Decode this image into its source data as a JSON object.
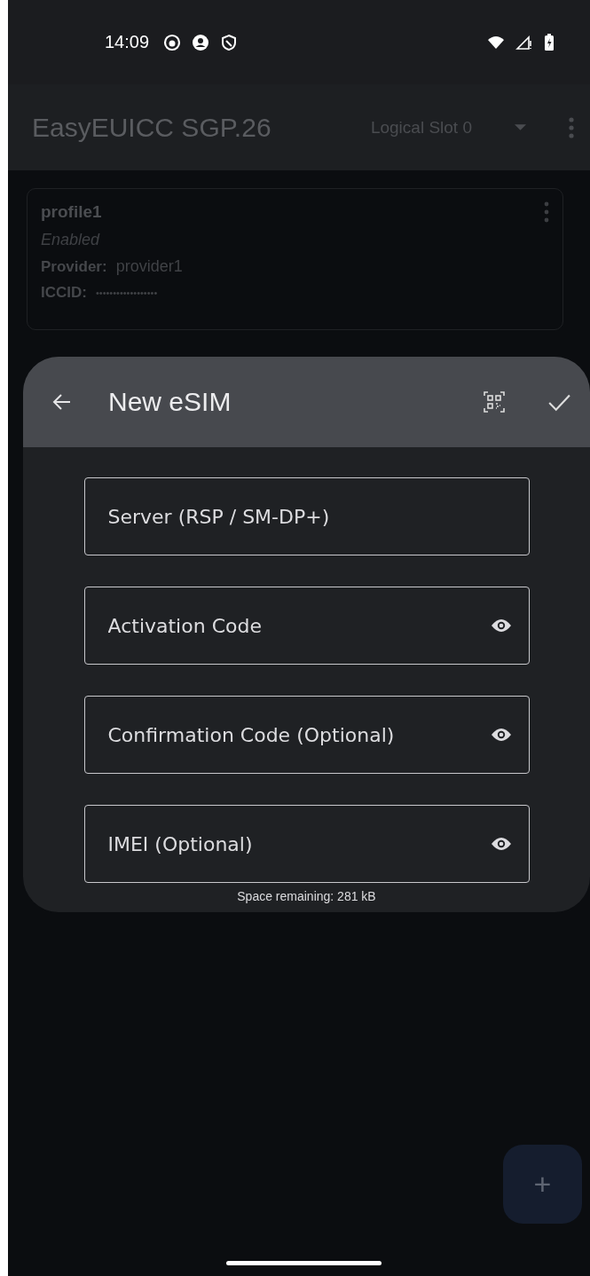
{
  "status_bar": {
    "time": "14:09"
  },
  "app_bar": {
    "title": "EasyEUICC SGP.26",
    "slot_selector": "Logical Slot 0"
  },
  "profile": {
    "name": "profile1",
    "state": "Enabled",
    "provider_label": "Provider:",
    "provider": "provider1",
    "iccid_label": "ICCID:",
    "iccid": "••••••••••••••••••"
  },
  "dialog": {
    "title": "New eSIM",
    "fields": [
      {
        "placeholder": "Server (RSP / SM-DP+)",
        "kind": "plain"
      },
      {
        "placeholder": "Activation Code",
        "kind": "secret"
      },
      {
        "placeholder": "Confirmation Code (Optional)",
        "kind": "secret"
      },
      {
        "placeholder": "IMEI (Optional)",
        "kind": "secret"
      }
    ],
    "footer": "Space remaining: 281 kB"
  },
  "fab": {
    "label": "+"
  }
}
